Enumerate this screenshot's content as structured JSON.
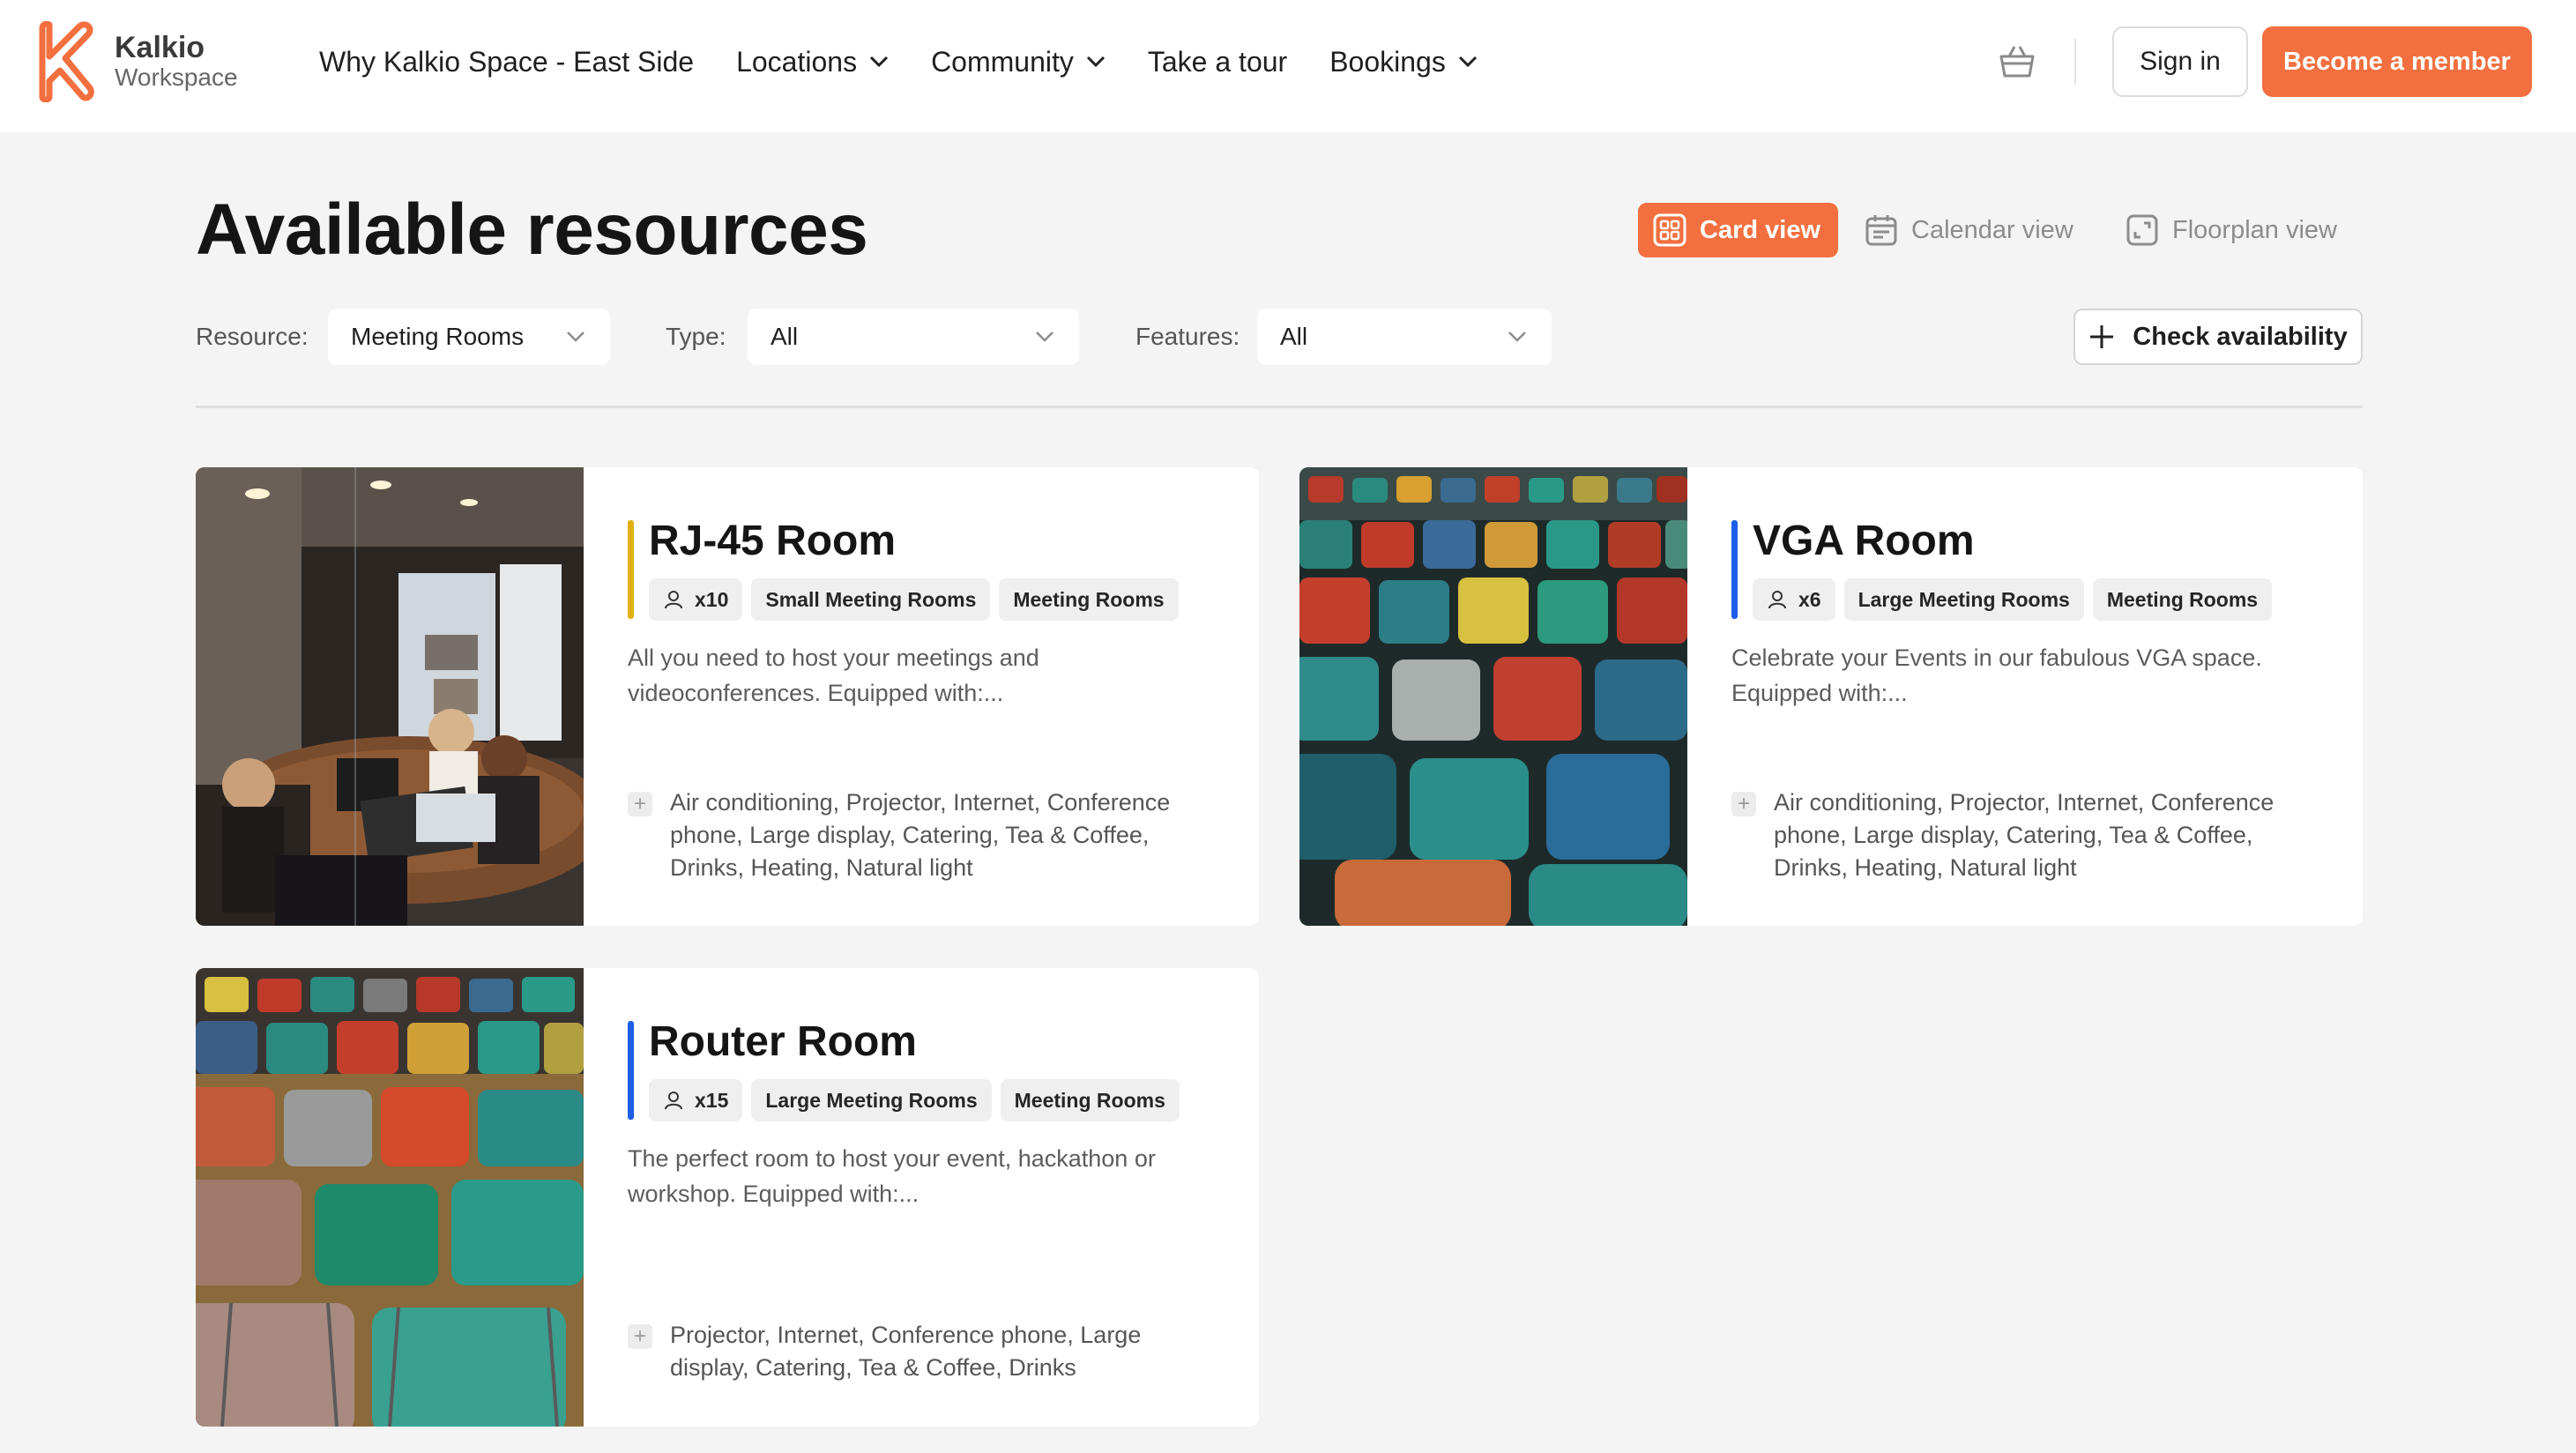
{
  "header": {
    "logo": {
      "name": "Kalkio",
      "sub": "Workspace",
      "icon": "kalkio-k-logo",
      "color": "#f36f3f"
    },
    "nav": [
      {
        "label": "Why Kalkio Space - East Side",
        "dropdown": false
      },
      {
        "label": "Locations",
        "dropdown": true
      },
      {
        "label": "Community",
        "dropdown": true
      },
      {
        "label": "Take a tour",
        "dropdown": false
      },
      {
        "label": "Bookings",
        "dropdown": true
      }
    ],
    "cart_icon": "basket-icon",
    "sign_in": "Sign in",
    "become_member": "Become a member",
    "accent": "#f36f3f"
  },
  "main": {
    "title": "Available resources",
    "views": {
      "card": "Card view",
      "calendar": "Calendar view",
      "floorplan": "Floorplan view",
      "active": "card"
    },
    "filters": {
      "resource": {
        "label": "Resource:",
        "value": "Meeting Rooms"
      },
      "type": {
        "label": "Type:",
        "value": "All"
      },
      "features": {
        "label": "Features:",
        "value": "All"
      }
    },
    "check_availability": "Check availability"
  },
  "cards": [
    {
      "title": "RJ-45 Room",
      "accent": "#e0b010",
      "capacity": "x10",
      "tags": [
        "Small Meeting Rooms",
        "Meeting Rooms"
      ],
      "description": "All you need to host your meetings and videoconferences. Equipped with:...",
      "features": "Air conditioning, Projector, Internet, Conference phone, Large display, Catering, Tea & Coffee, Drinks, Heating, Natural light"
    },
    {
      "title": "VGA Room",
      "accent": "#1e5ee6",
      "capacity": "x6",
      "tags": [
        "Large Meeting Rooms",
        "Meeting Rooms"
      ],
      "description": "Celebrate your Events in our fabulous VGA space. Equipped with:...",
      "features": "Air conditioning, Projector, Internet, Conference phone, Large display, Catering, Tea & Coffee, Drinks, Heating, Natural light"
    },
    {
      "title": "Router Room",
      "accent": "#1e5ee6",
      "capacity": "x15",
      "tags": [
        "Large Meeting Rooms",
        "Meeting Rooms"
      ],
      "description": "The perfect room to host your event, hackathon or workshop. Equipped with:...",
      "features": "Projector, Internet, Conference phone, Large display, Catering, Tea & Coffee, Drinks"
    }
  ]
}
